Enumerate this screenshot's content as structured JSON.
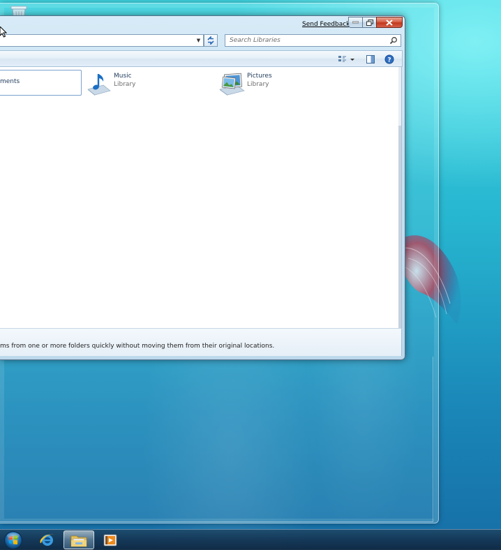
{
  "window": {
    "send_feedback": "Send Feedback",
    "search_placeholder": "Search Libraries",
    "libraries": [
      {
        "name": "ments",
        "sub": "",
        "icon": "documents-library-icon",
        "selected": true
      },
      {
        "name": "Music",
        "sub": "Library",
        "icon": "music-library-icon"
      },
      {
        "name": "Pictures",
        "sub": "Library",
        "icon": "pictures-library-icon"
      }
    ],
    "details_text": "ms from one or more folders quickly without moving them from their original locations."
  },
  "taskbar": {
    "apps": [
      "internet-explorer-icon",
      "windows-explorer-icon",
      "media-player-icon"
    ]
  },
  "colors": {
    "desktop": "#27b6d0",
    "close_button": "#c2391d",
    "selection_border": "#7da2ce",
    "link_text": "#1e395b"
  }
}
